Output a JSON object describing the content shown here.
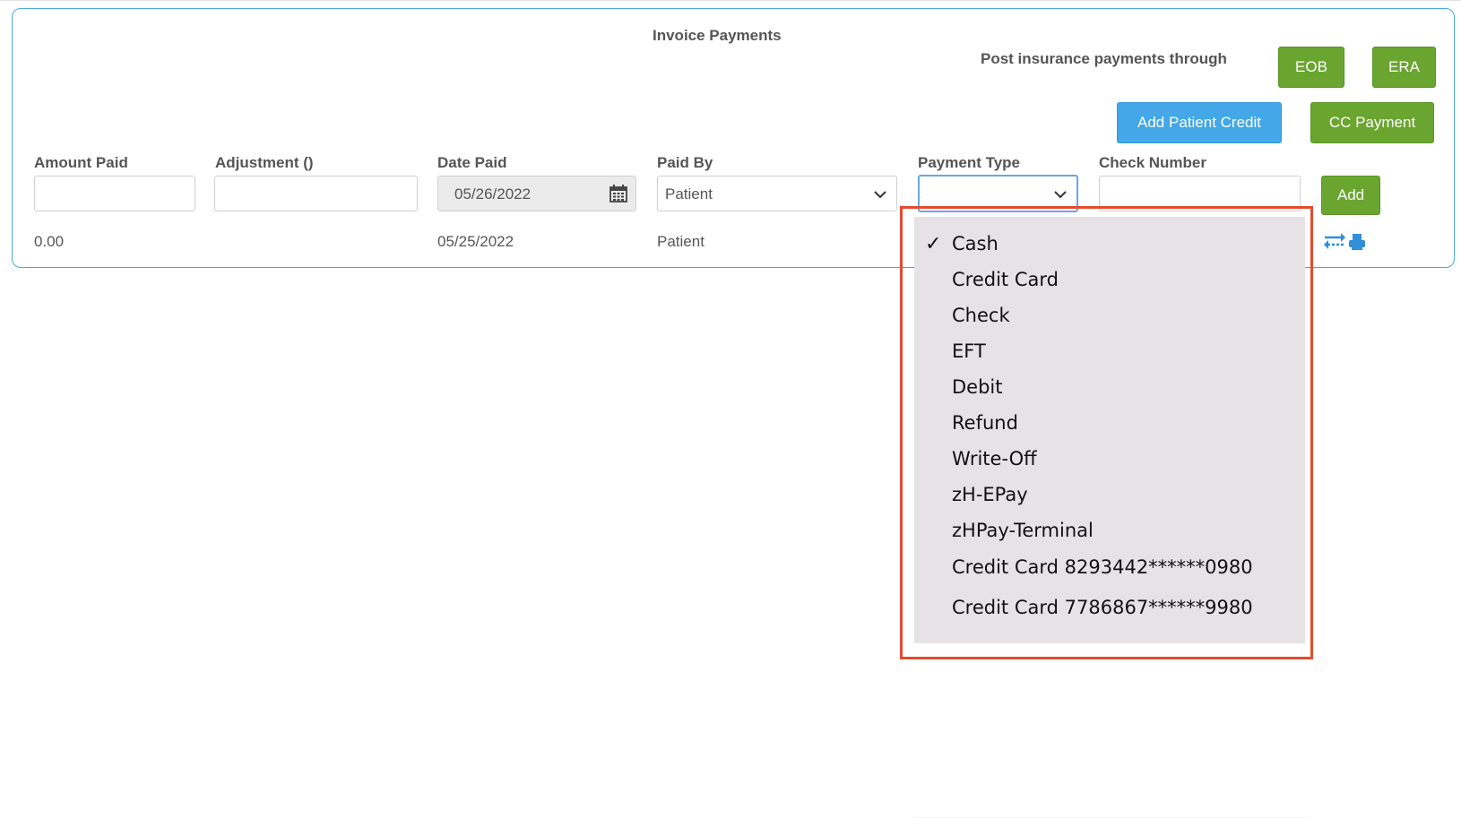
{
  "panel": {
    "title": "Invoice Payments",
    "post_text": "Post insurance payments through",
    "buttons": {
      "eob": "EOB",
      "era": "ERA",
      "add_patient_credit": "Add Patient Credit",
      "cc_payment": "CC Payment",
      "add": "Add"
    }
  },
  "form": {
    "labels": {
      "amount_paid": "Amount Paid",
      "adjustment": "Adjustment ()",
      "date_paid": "Date Paid",
      "paid_by": "Paid By",
      "payment_type": "Payment Type",
      "check_number": "Check Number"
    },
    "values": {
      "amount_paid": "",
      "adjustment": "",
      "date_paid": "05/26/2022",
      "paid_by": "Patient",
      "payment_type": "",
      "check_number": ""
    }
  },
  "payment_row": {
    "amount": "0.00",
    "date": "05/25/2022",
    "paid_by": "Patient"
  },
  "dropdown": {
    "options": [
      {
        "label": "Cash",
        "checked": true
      },
      {
        "label": "Credit Card"
      },
      {
        "label": "Check"
      },
      {
        "label": "EFT"
      },
      {
        "label": "Debit"
      },
      {
        "label": "Refund"
      },
      {
        "label": "Write-Off"
      },
      {
        "label": "zH-EPay"
      },
      {
        "label": "zHPay-Terminal"
      },
      {
        "label": "Credit Card",
        "number": "8293442******0980"
      },
      {
        "label": "Credit Card",
        "number": "7786867******9980"
      }
    ],
    "check_mark": "✓"
  },
  "colors": {
    "panel_border": "#4aa8df",
    "green_button": "#6aa52f",
    "blue_button": "#43a7e8",
    "highlight": "#e34b2e",
    "dropdown_bg": "#e6e2e6"
  },
  "icons": {
    "date_picker": "calendar-icon",
    "select": "chevron-down-icon",
    "row_actions": [
      "transfer-icon",
      "print-icon"
    ]
  }
}
